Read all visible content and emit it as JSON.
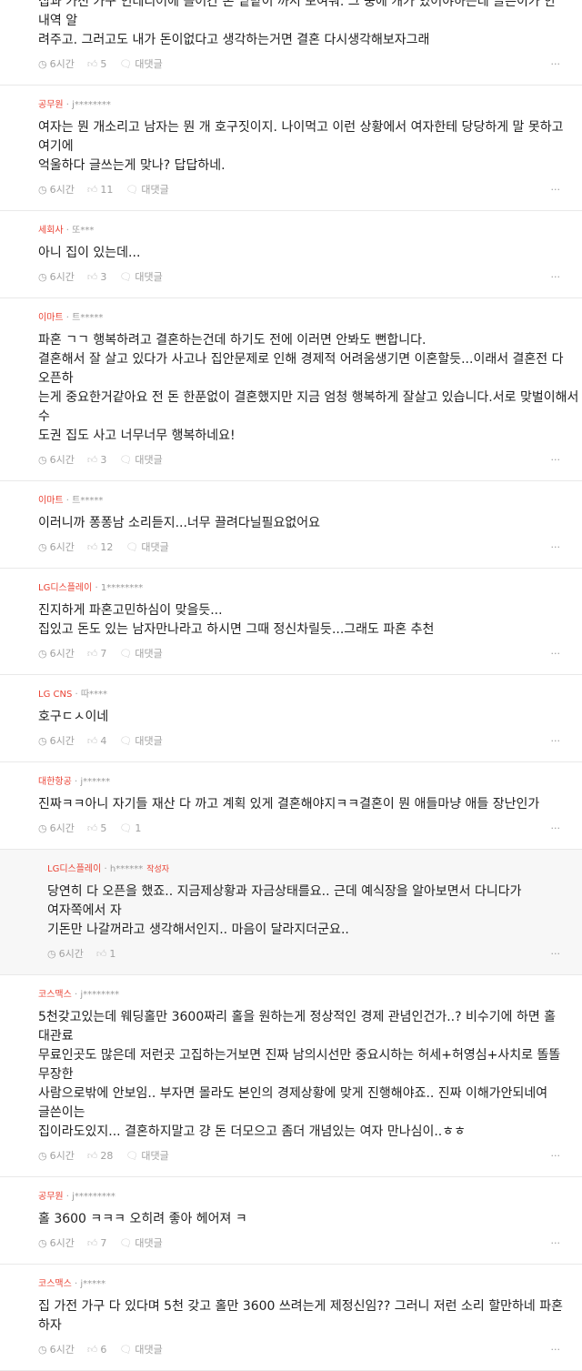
{
  "comments": [
    {
      "company": "",
      "nick": "",
      "text": "집과 가전 가구 인테리어에 들어간 돈 밑밭이 까서 보여줘. 그 중에 개가 있어야하는데 글쓴이가 안 내역 알\n려주고. 그러고도 내가 돈이없다고 생각하는거면 결혼 다시생각해보자그래",
      "time": "6시간",
      "likes": "5",
      "reply_label": "대댓글",
      "more": "···"
    },
    {
      "company": "공무원",
      "nick": "j********",
      "text": "여자는 뭔 개소리고 남자는 뭔 개 호구짓이지. 나이먹고 이런 상황에서 여자한테 당당하게 말 못하고 여기에\n억울하다 글쓰는게 맞나? 답답하네.",
      "time": "6시간",
      "likes": "11",
      "reply_label": "대댓글",
      "more": "···"
    },
    {
      "company": "세회사",
      "nick": "또***",
      "text": "아니 집이 있는데...",
      "time": "6시간",
      "likes": "3",
      "reply_label": "대댓글",
      "more": "···"
    },
    {
      "company": "이마트",
      "nick": "트*****",
      "text": "파혼 ㄱㄱ 행복하려고 결혼하는건데 하기도 전에 이러면 안봐도 뻔합니다.\n결혼해서 잘 살고 있다가 사고나 집안문제로 인해 경제적 어려움생기면 이혼할듯...이래서 결혼전 다 오픈하\n는게 중요한거같아요 전 돈 한푼없이 결혼했지만 지금 엄청 행복하게 잘살고 있습니다.서로 맞벌이해서 수\n도권 집도 사고 너무너무 행복하네요!",
      "time": "6시간",
      "likes": "3",
      "reply_label": "대댓글",
      "more": "···"
    },
    {
      "company": "이마트",
      "nick": "트*****",
      "text": "이러니까 퐁퐁남 소리듣지...너무 끌려다닐필요없어요",
      "time": "6시간",
      "likes": "12",
      "reply_label": "대댓글",
      "more": "···"
    },
    {
      "company": "LG디스플레이",
      "nick": "1********",
      "text": "진지하게 파혼고민하심이 맞을듯...\n집있고 돈도 있는 남자만나라고 하시면 그때 정신차릴듯...그래도 파혼 추천",
      "time": "6시간",
      "likes": "7",
      "reply_label": "대댓글",
      "more": "···"
    },
    {
      "company": "LG CNS",
      "nick": "따****",
      "text": "호구ㄷㅅ이네",
      "time": "6시간",
      "likes": "4",
      "reply_label": "대댓글",
      "more": "···"
    },
    {
      "company": "대한항공",
      "nick": "j******",
      "text": "진짜ㅋㅋ아니 자기들 재산 다 까고 계획 있게 결혼해야지ㅋㅋ결혼이 뭔 애들마냥 애들 장난인가",
      "time": "6시간",
      "likes": "5",
      "reply_label": "1",
      "more": "···"
    }
  ],
  "reply": {
    "company": "LG디스플레이",
    "nick": "h******",
    "badge": "작성자",
    "text": "당연히 다 오픈을 했죠.. 지금제상황과 자금상태를요.. 근데 예식장을 알아보면서 다니다가 여자쪽에서 자\n기돈만 나갈꺼라고 생각해서인지.. 마음이 달라지더군요..",
    "time": "6시간",
    "likes": "1",
    "more": "···"
  },
  "comments2": [
    {
      "company": "코스맥스",
      "nick": "j********",
      "text": "5천갖고있는데 웨딩홀만 3600짜리 홀을 원하는게 정상적인 경제 관념인건가..? 비수기에 하면 홀 대관료\n무료인곳도 많은데 저런곳 고집하는거보면 진짜 남의시선만 중요시하는 허세+허영심+사치로 똘똘 무장한\n사람으로밖에 안보임.. 부자면 몰라도 본인의 경제상황에 맞게 진행해야죠.. 진짜 이해가안되네여 글쓴이는\n집이라도있지... 결혼하지말고 걍 돈 더모으고 좀더 개념있는 여자 만나심이..ㅎㅎ",
      "time": "6시간",
      "likes": "28",
      "reply_label": "대댓글",
      "more": "···"
    },
    {
      "company": "공무원",
      "nick": "j*********",
      "text": "홀 3600 ㅋㅋㅋ 오히려 좋아 헤어져 ㅋ",
      "time": "6시간",
      "likes": "7",
      "reply_label": "대댓글",
      "more": "···"
    },
    {
      "company": "코스맥스",
      "nick": "j*****",
      "text": "집 가전 가구 다 있다며 5천 갖고 홀만 3600 쓰려는게 제정신임?? 그러니 저런 소리 할만하네 파혼 하자",
      "time": "6시간",
      "likes": "6",
      "reply_label": "대댓글",
      "more": "···"
    }
  ],
  "icons": {
    "clock": "clock-icon",
    "like": "thumbs-up-icon",
    "reply": "speech-bubble-icon",
    "more": "more-dots-icon"
  },
  "colors": {
    "company": "#ea4335",
    "nick": "#9a9a9a",
    "meta": "#a0a0a0",
    "reply_bg": "#f7f7f7"
  }
}
